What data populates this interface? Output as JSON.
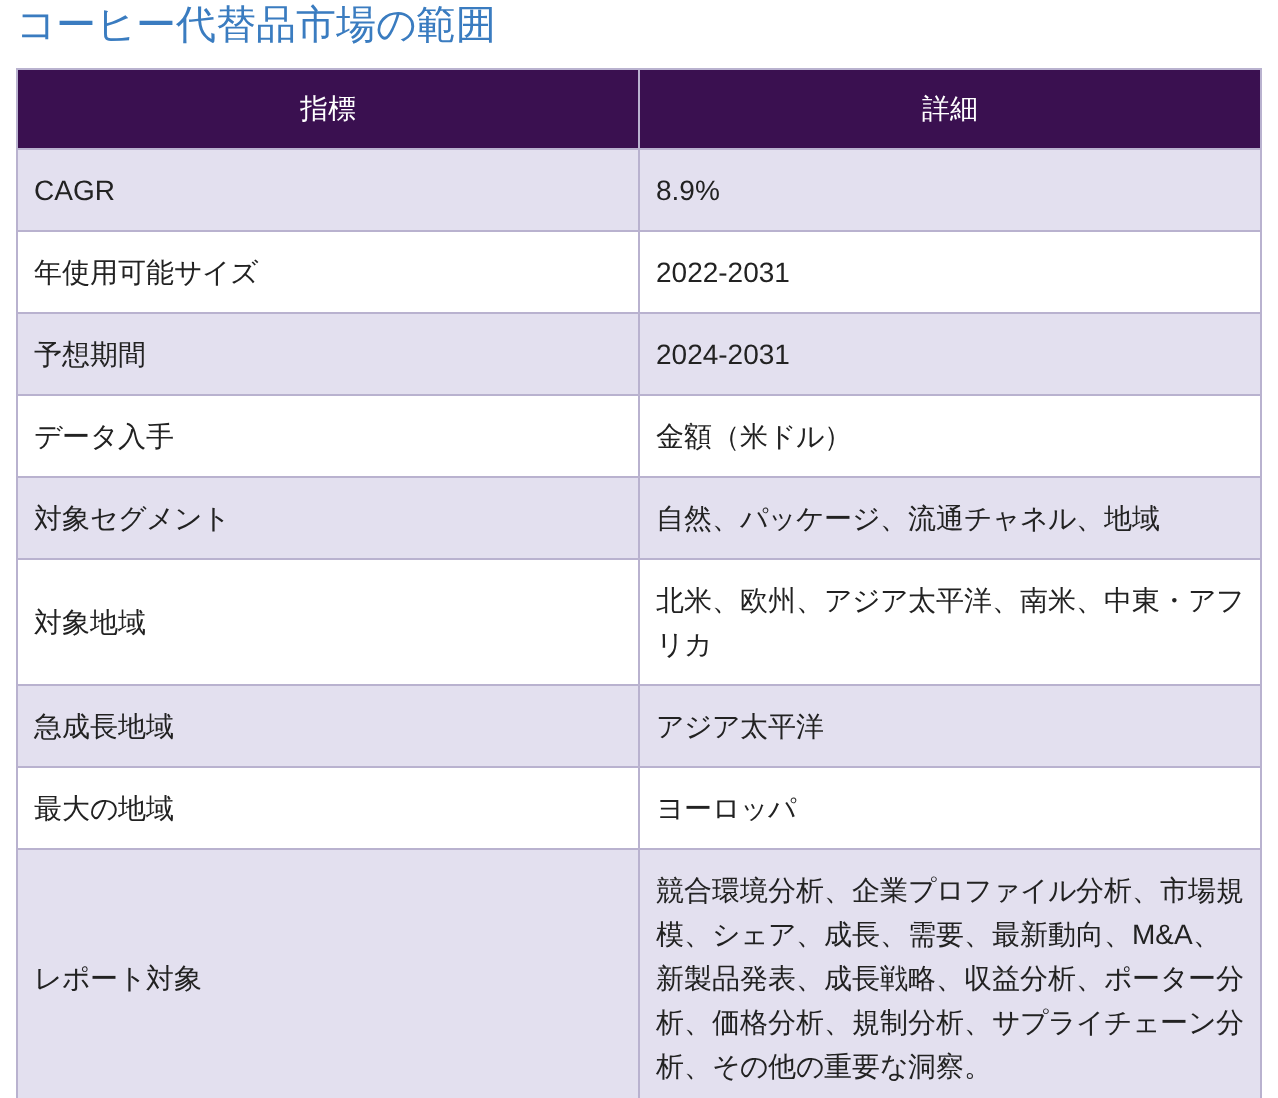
{
  "title": "コーヒー代替品市場の範囲",
  "table": {
    "columns": [
      "指標",
      "詳細"
    ],
    "rows": [
      [
        "CAGR",
        "8.9%"
      ],
      [
        "年使用可能サイズ",
        "2022-2031"
      ],
      [
        "予想期間",
        "2024-2031"
      ],
      [
        "データ入手",
        "金額（米ドル）"
      ],
      [
        "対象セグメント",
        "自然、パッケージ、流通チャネル、地域"
      ],
      [
        "対象地域",
        "北米、欧州、アジア太平洋、南米、中東・アフリカ"
      ],
      [
        "急成長地域",
        "アジア太平洋"
      ],
      [
        "最大の地域",
        "ヨーロッパ"
      ],
      [
        "レポート対象",
        "競合環境分析、企業プロファイル分析、市場規模、シェア、成長、需要、最新動向、M&A、新製品発表、成長戦略、収益分析、ポーター分析、価格分析、規制分析、サプライチェーン分析、その他の重要な洞察。"
      ]
    ]
  }
}
